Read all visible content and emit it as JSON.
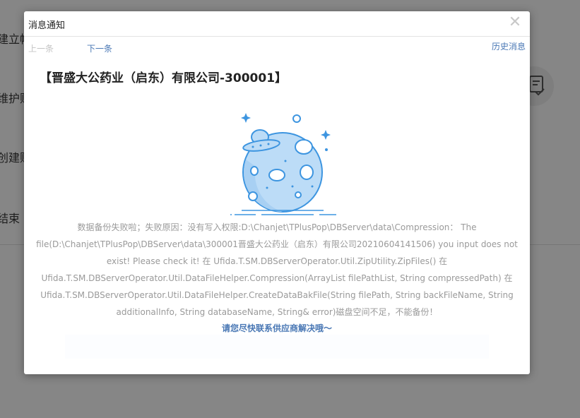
{
  "background": {
    "steps": [
      {
        "label": "建立帐"
      },
      {
        "label": "维护账"
      },
      {
        "label": "创建账"
      },
      {
        "label": "结束"
      }
    ]
  },
  "dialog": {
    "title": "消息通知",
    "close_symbol": "✕",
    "prev_label": "上一条",
    "next_label": "下一条",
    "history_label": "历史消息",
    "company_title": "【晋盛大公药业（启东）有限公司-300001】",
    "message": "数据备份失败啦；失败原因：没有写入权限:D:\\Chanjet\\TPlusPop\\DBServer\\data\\Compression： The file(D:\\Chanjet\\TPlusPop\\DBServer\\data\\300001晋盛大公药业（启东）有限公司20210604141506) you input does not exist! Please check it! 在 Ufida.T.SM.DBServerOperator.Util.ZipUtility.ZipFiles() 在 Ufida.T.SM.DBServerOperator.Util.DataFileHelper.Compression(ArrayList filePathList, String compressedPath) 在 Ufida.T.SM.DBServerOperator.Util.DataFileHelper.CreateDataBakFile(String filePath, String backFileName, String additionalInfo, String databaseName, String& error)磁盘空间不足，不能备份！",
    "contact": "请您尽快联系供应商解决哦～"
  },
  "colors": {
    "accent": "#4a78b5",
    "planet_fill": "#bcdcf7",
    "planet_stroke": "#3d95e0"
  }
}
